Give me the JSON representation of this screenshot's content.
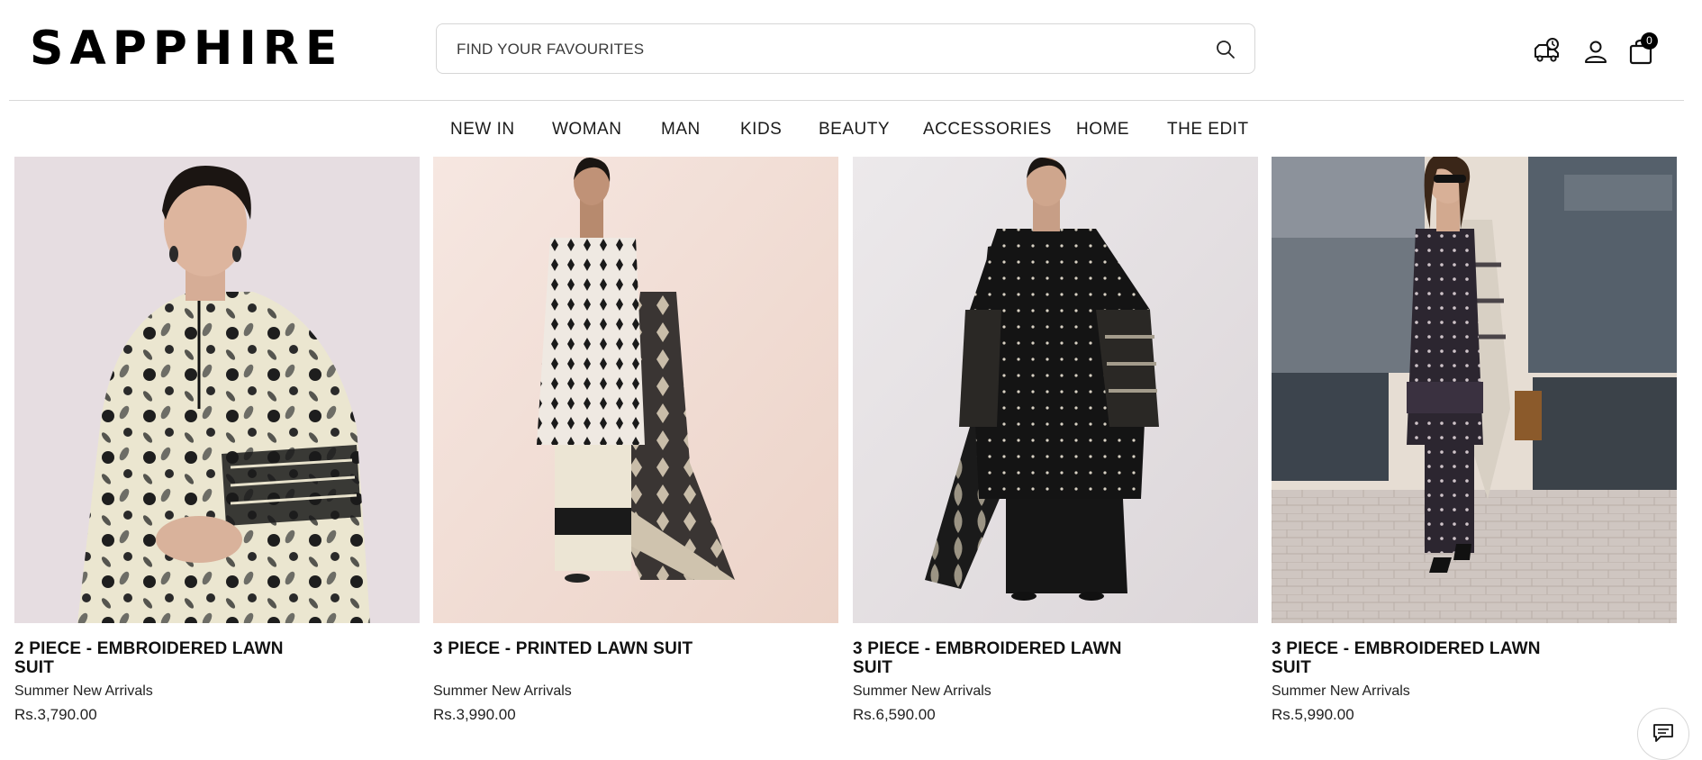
{
  "header": {
    "logo": "SAPPHIRE",
    "search_placeholder": "FIND YOUR FAVOURITES",
    "cart_count": "0",
    "icons": [
      "delivery-truck-icon",
      "user-icon",
      "shopping-bag-icon",
      "search-icon"
    ]
  },
  "nav": {
    "items": [
      "NEW IN",
      "WOMAN",
      "MAN",
      "KIDS",
      "BEAUTY",
      "ACCESSORIES",
      "HOME",
      "THE EDIT"
    ]
  },
  "products": [
    {
      "title": "2 PIECE - EMBROIDERED LAWN SUIT",
      "subtitle": "Summer New Arrivals",
      "price": "Rs.3,790.00"
    },
    {
      "title": "3 PIECE - PRINTED LAWN SUIT",
      "subtitle": "Summer New Arrivals",
      "price": "Rs.3,990.00"
    },
    {
      "title": "3 PIECE - EMBROIDERED LAWN SUIT",
      "subtitle": "Summer New Arrivals",
      "price": "Rs.6,590.00"
    },
    {
      "title": "3 PIECE - EMBROIDERED LAWN SUIT",
      "subtitle": "Summer New Arrivals",
      "price": "Rs.5,990.00"
    }
  ],
  "colors": {
    "text": "#111111",
    "border": "#d6d6d6",
    "badge": "#000000"
  }
}
